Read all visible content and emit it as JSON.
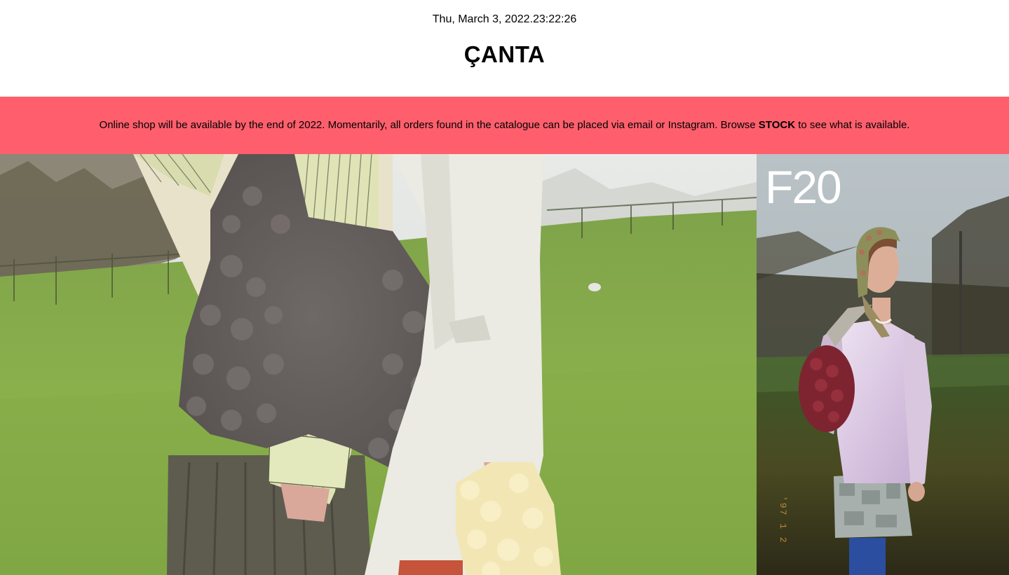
{
  "header": {
    "datetime": "Thu, March 3, 2022.23:22:26",
    "brand": "ÇANTA"
  },
  "banner": {
    "text_before": "Online shop will be available by the end of 2022. Momentarily, all orders found in the catalogue can be placed via email or Instagram. Browse ",
    "link_label": "STOCK",
    "text_after": " to see what is available.",
    "background_color": "#ff5f6d"
  },
  "gallery": {
    "collection_label": "F20",
    "film_stamp": "'97  1  2"
  }
}
